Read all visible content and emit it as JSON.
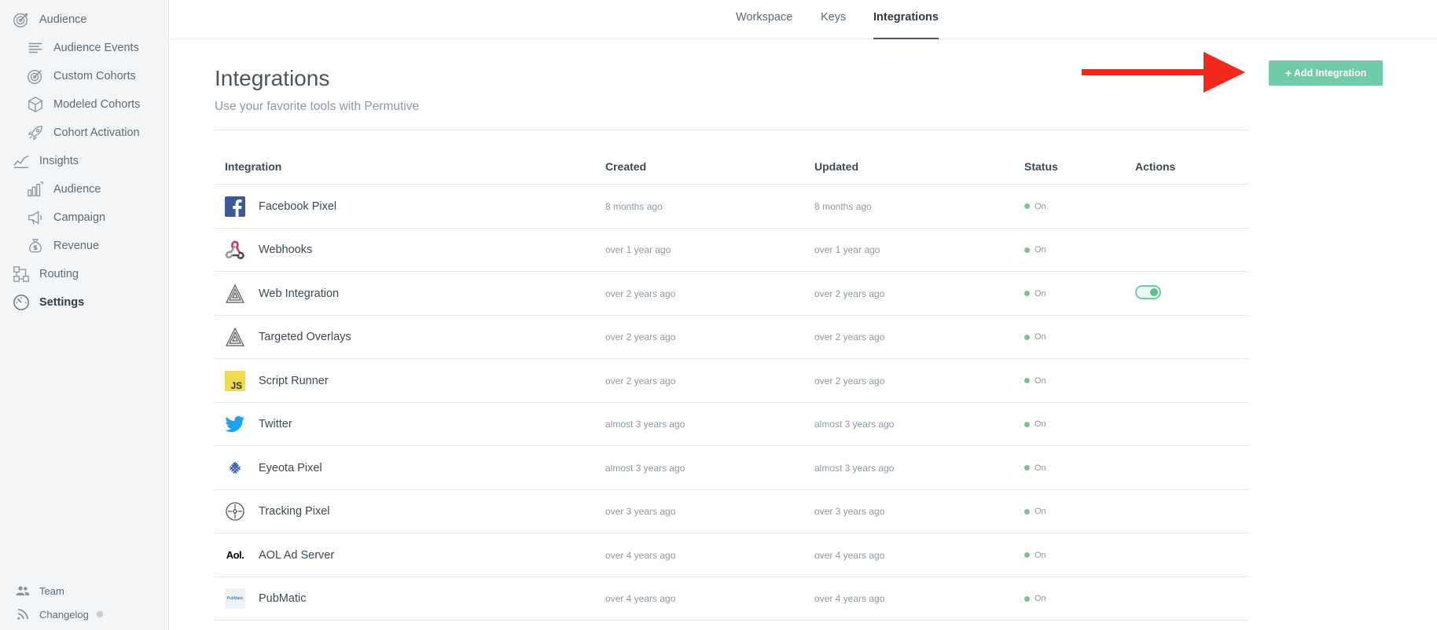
{
  "sidebar": {
    "items": [
      {
        "label": "Audience",
        "icon": "target-icon",
        "level": "top"
      },
      {
        "label": "Audience Events",
        "icon": "list-icon",
        "level": "sub"
      },
      {
        "label": "Custom Cohorts",
        "icon": "target-icon",
        "level": "sub"
      },
      {
        "label": "Modeled Cohorts",
        "icon": "cube-icon",
        "level": "sub"
      },
      {
        "label": "Cohort Activation",
        "icon": "rocket-icon",
        "level": "sub"
      },
      {
        "label": "Insights",
        "icon": "trend-icon",
        "level": "top"
      },
      {
        "label": "Audience",
        "icon": "bar-chart-icon",
        "level": "sub"
      },
      {
        "label": "Campaign",
        "icon": "megaphone-icon",
        "level": "sub"
      },
      {
        "label": "Revenue",
        "icon": "money-bag-icon",
        "level": "sub"
      },
      {
        "label": "Routing",
        "icon": "routing-icon",
        "level": "top"
      },
      {
        "label": "Settings",
        "icon": "gauge-icon",
        "level": "top",
        "active": true
      }
    ],
    "bottom": [
      {
        "label": "Team",
        "icon": "people-icon"
      },
      {
        "label": "Changelog",
        "icon": "rss-icon"
      }
    ]
  },
  "tabs": [
    {
      "label": "Workspace"
    },
    {
      "label": "Keys"
    },
    {
      "label": "Integrations",
      "active": true
    }
  ],
  "header": {
    "title": "Integrations",
    "subtitle": "Use your favorite tools with Permutive",
    "add_button": "Add Integration",
    "add_button_icon": "plus-icon"
  },
  "table": {
    "columns": [
      "Integration",
      "Created",
      "Updated",
      "Status",
      "Actions"
    ],
    "rows": [
      {
        "name": "Facebook Pixel",
        "logo": "facebook-logo-icon",
        "created": "8 months ago",
        "updated": "8 months ago",
        "status": "On"
      },
      {
        "name": "Webhooks",
        "logo": "webhooks-logo-icon",
        "created": "over 1 year ago",
        "updated": "over 1 year ago",
        "status": "On"
      },
      {
        "name": "Web Integration",
        "logo": "permutive-logo-icon",
        "created": "over 2 years ago",
        "updated": "over 2 years ago",
        "status": "On",
        "toggle": true
      },
      {
        "name": "Targeted Overlays",
        "logo": "permutive-logo-icon",
        "created": "over 2 years ago",
        "updated": "over 2 years ago",
        "status": "On"
      },
      {
        "name": "Script Runner",
        "logo": "js-logo-icon",
        "created": "over 2 years ago",
        "updated": "over 2 years ago",
        "status": "On"
      },
      {
        "name": "Twitter",
        "logo": "twitter-logo-icon",
        "created": "almost 3 years ago",
        "updated": "almost 3 years ago",
        "status": "On"
      },
      {
        "name": "Eyeota Pixel",
        "logo": "eyeota-logo-icon",
        "created": "almost 3 years ago",
        "updated": "almost 3 years ago",
        "status": "On"
      },
      {
        "name": "Tracking Pixel",
        "logo": "crosshair-logo-icon",
        "created": "over 3 years ago",
        "updated": "over 3 years ago",
        "status": "On"
      },
      {
        "name": "AOL Ad Server",
        "logo": "aol-logo-icon",
        "logo_text": "Aol.",
        "created": "over 4 years ago",
        "updated": "over 4 years ago",
        "status": "On"
      },
      {
        "name": "PubMatic",
        "logo": "pubmatic-logo-icon",
        "logo_text": "PubMatic",
        "created": "over 4 years ago",
        "updated": "over 4 years ago",
        "status": "On"
      }
    ]
  },
  "colors": {
    "accent": "#6fcca7",
    "status_on": "#7dc48a",
    "annotation_arrow": "#f2281b"
  }
}
